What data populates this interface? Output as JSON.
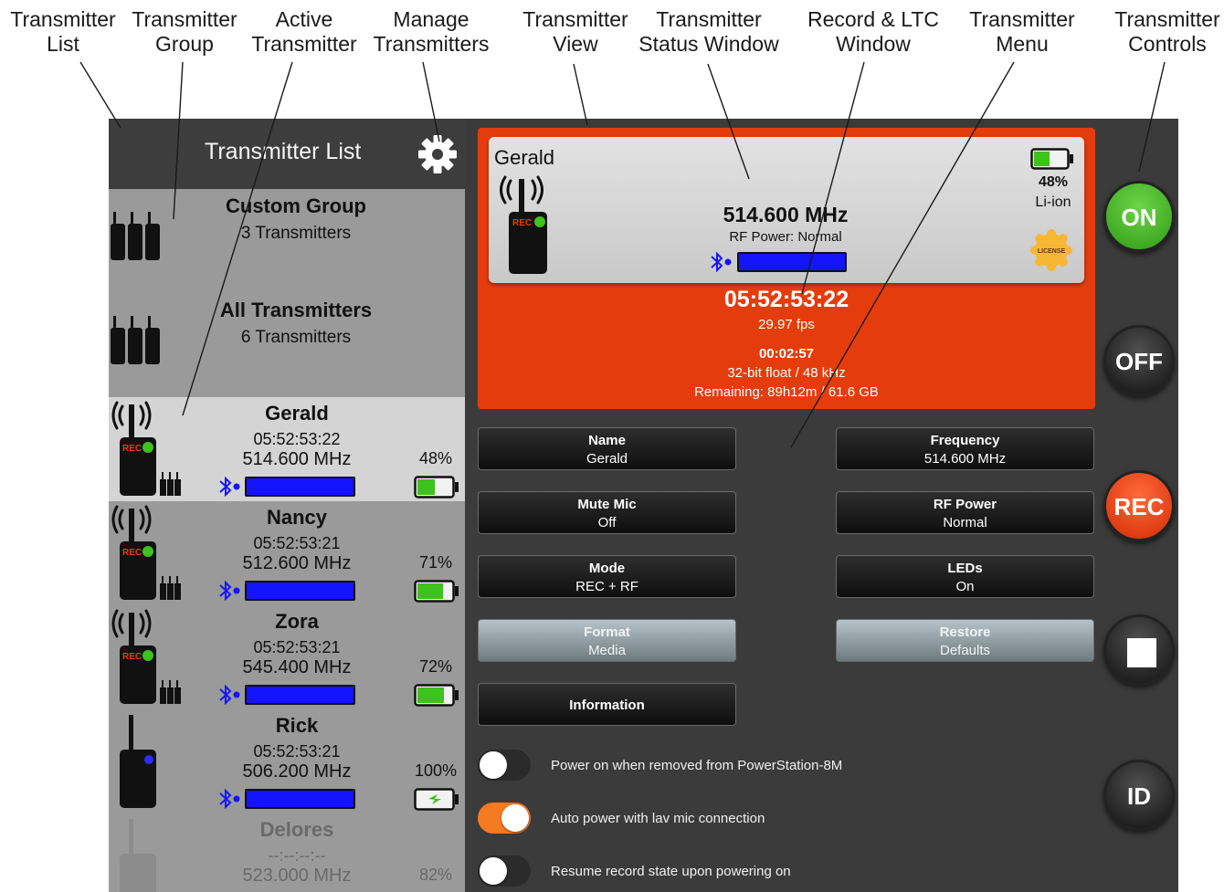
{
  "callouts": [
    {
      "text": "Transmitter\nList"
    },
    {
      "text": "Transmitter\nGroup"
    },
    {
      "text": "Active\nTransmitter"
    },
    {
      "text": "Manage\nTransmitters"
    },
    {
      "text": "Transmitter\nView"
    },
    {
      "text": "Transmitter\nStatus Window"
    },
    {
      "text": "Record & LTC\nWindow"
    },
    {
      "text": "Transmitter\nMenu"
    },
    {
      "text": "Transmitter\nControls"
    }
  ],
  "list": {
    "title": "Transmitter List",
    "manage_icon": "gear-icon",
    "groups": [
      {
        "name": "Custom Group",
        "count": "3 Transmitters"
      },
      {
        "name": "All Transmitters",
        "count": "6 Transmitters"
      }
    ],
    "transmitters": [
      {
        "name": "Gerald",
        "timecode": "05:52:53:22",
        "frequency": "514.600 MHz",
        "battery": "48%",
        "battery_level": 48,
        "state": "rec",
        "active": true
      },
      {
        "name": "Nancy",
        "timecode": "05:52:53:21",
        "frequency": "512.600 MHz",
        "battery": "71%",
        "battery_level": 71,
        "state": "rec",
        "active": false
      },
      {
        "name": "Zora",
        "timecode": "05:52:53:21",
        "frequency": "545.400 MHz",
        "battery": "72%",
        "battery_level": 72,
        "state": "rec",
        "active": false
      },
      {
        "name": "Rick",
        "timecode": "05:52:53:21",
        "frequency": "506.200 MHz",
        "battery": "100%",
        "battery_level": 100,
        "state": "charging",
        "active": false
      },
      {
        "name": "Delores",
        "timecode": "--:--:--:--",
        "frequency": "523.000 MHz",
        "battery": "82%",
        "battery_level": 82,
        "state": "offline",
        "active": false
      }
    ]
  },
  "status": {
    "name": "Gerald",
    "frequency": "514.600 MHz",
    "rf_power": "RF Power: Normal",
    "battery": "48%",
    "battery_level": 48,
    "chemistry": "Li-ion",
    "license_badge": "LICENSE",
    "rec_badge": "REC"
  },
  "record": {
    "timecode": "05:52:53:22",
    "fps": "29.97 fps",
    "elapsed": "00:02:57",
    "format": "32-bit float / 48 kHz",
    "remaining": "Remaining: 89h12m / 61.6 GB"
  },
  "menu": {
    "name": {
      "label": "Name",
      "value": "Gerald"
    },
    "frequency": {
      "label": "Frequency",
      "value": "514.600 MHz"
    },
    "mute_mic": {
      "label": "Mute Mic",
      "value": "Off"
    },
    "rf_power": {
      "label": "RF Power",
      "value": "Normal"
    },
    "mode": {
      "label": "Mode",
      "value": "REC + RF"
    },
    "leds": {
      "label": "LEDs",
      "value": "On"
    },
    "format_media": {
      "label": "Format",
      "value": "Media"
    },
    "restore_defaults": {
      "label": "Restore",
      "value": "Defaults"
    },
    "information": {
      "label": "Information"
    }
  },
  "toggles": [
    {
      "label": "Power on when removed from PowerStation-8M",
      "on": false
    },
    {
      "label": "Auto power with lav mic connection",
      "on": true
    },
    {
      "label": "Resume record state upon powering on",
      "on": false
    }
  ],
  "controls": {
    "on": "ON",
    "off": "OFF",
    "rec": "REC",
    "stop_icon": "stop-icon",
    "id": "ID"
  },
  "colors": {
    "rec_red": "#e53c0d",
    "on_green": "#3aa61c",
    "toggle_orange": "#f57a21",
    "meter_blue": "#1414ff",
    "tc_badge_blue": "#1d3fd4"
  }
}
